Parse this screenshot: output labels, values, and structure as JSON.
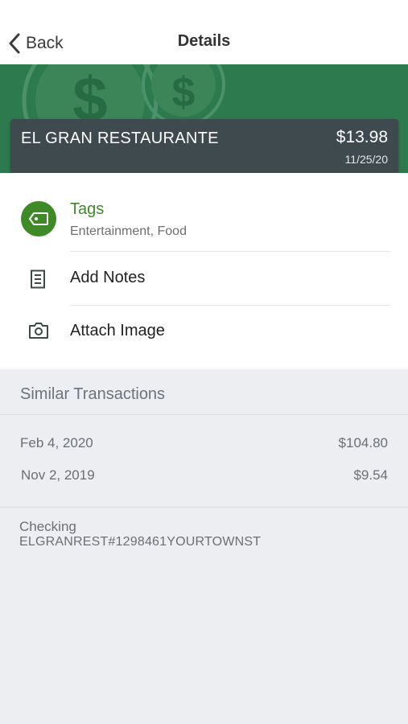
{
  "navbar": {
    "back_label": "Back",
    "title": "Details",
    "icons": {
      "back": "chevron-left-icon"
    }
  },
  "banner": {
    "background_color": "#2e7a4f",
    "decoration_icon": "dollar-coin-icon"
  },
  "transaction": {
    "merchant": "EL GRAN RESTAURANTE",
    "amount": "$13.98",
    "date": "11/25/20",
    "card_color": "#3f4a4e"
  },
  "actions": {
    "tags": {
      "title": "Tags",
      "value": "Entertainment, Food",
      "icon": "tag-icon",
      "accent_color": "#3d8a27"
    },
    "notes": {
      "label": "Add Notes",
      "icon": "notes-icon"
    },
    "image": {
      "label": "Attach Image",
      "icon": "camera-icon"
    }
  },
  "similar": {
    "title": "Similar Transactions",
    "items": [
      {
        "date": "Feb 4, 2020",
        "amount": "$104.80"
      },
      {
        "date": "Nov 2, 2019",
        "amount": "$9.54"
      }
    ]
  },
  "account": {
    "type": "Checking",
    "description": "ELGRANREST#1298461YOURTOWNST"
  }
}
